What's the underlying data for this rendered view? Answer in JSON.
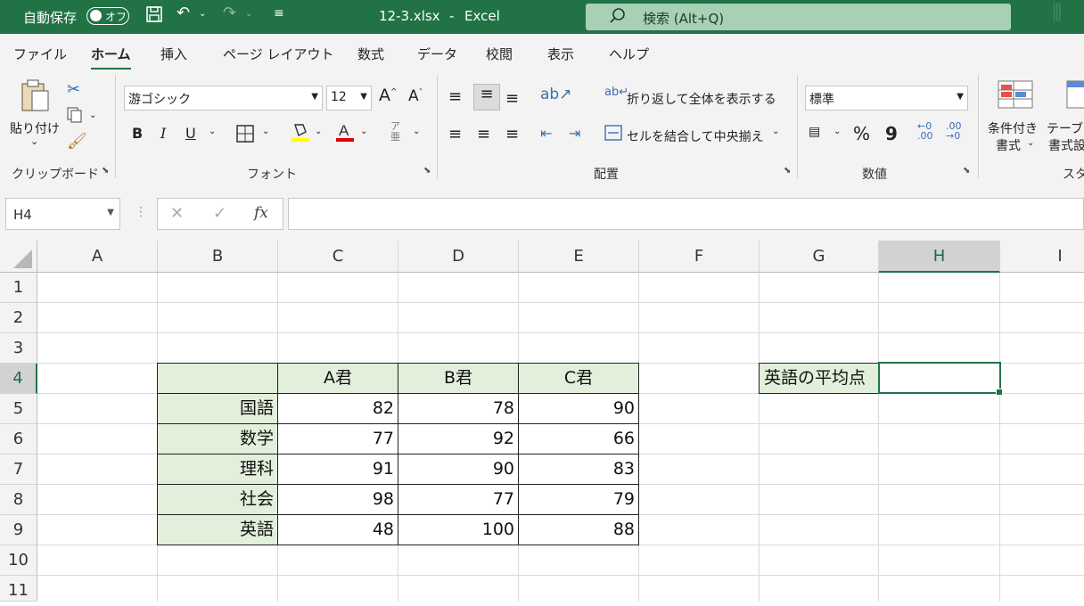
{
  "titlebar": {
    "autosave_label": "自動保存",
    "autosave_state": "オフ",
    "filename": "12-3.xlsx",
    "separator": "-",
    "app_name": "Excel",
    "search_placeholder": "検索 (Alt+Q)"
  },
  "menu": {
    "tabs": [
      "ファイル",
      "ホーム",
      "挿入",
      "ページ レイアウト",
      "数式",
      "データ",
      "校閲",
      "表示",
      "ヘルプ"
    ],
    "active": "ホーム"
  },
  "ribbon": {
    "clipboard": {
      "paste_label": "貼り付け",
      "group_label": "クリップボード"
    },
    "font": {
      "font_name": "游ゴシック",
      "font_size": "12",
      "bold": "B",
      "italic": "I",
      "underline": "U",
      "group_label": "フォント"
    },
    "alignment": {
      "wrap_text": "折り返して全体を表示する",
      "merge_center": "セルを結合して中央揃え",
      "group_label": "配置"
    },
    "number": {
      "format": "標準",
      "percent": "%",
      "comma": "9",
      "group_label": "数値"
    },
    "styles": {
      "conditional_line1": "条件付き",
      "conditional_line2": "書式",
      "table_line1": "テーブル",
      "table_line2": "書式設",
      "group_label": "スタ"
    }
  },
  "formula_bar": {
    "name_box": "H4",
    "fx_label": "fx",
    "formula": ""
  },
  "grid": {
    "columns": [
      "A",
      "B",
      "C",
      "D",
      "E",
      "F",
      "G",
      "H",
      "I"
    ],
    "rows": [
      "1",
      "2",
      "3",
      "4",
      "5",
      "6",
      "7",
      "8",
      "9",
      "10",
      "11"
    ],
    "selected_cell": "H4",
    "table": {
      "headers": [
        "",
        "A君",
        "B君",
        "C君"
      ],
      "subjects": [
        "国語",
        "数学",
        "理科",
        "社会",
        "英語"
      ],
      "scores": [
        [
          "82",
          "78",
          "90"
        ],
        [
          "77",
          "92",
          "66"
        ],
        [
          "91",
          "90",
          "83"
        ],
        [
          "98",
          "77",
          "79"
        ],
        [
          "48",
          "100",
          "88"
        ]
      ]
    },
    "g4_label": "英語の平均点",
    "h4_value": ""
  },
  "colors": {
    "accent": "#217346",
    "table_fill": "#e2efda",
    "search_bg": "#a7d0b4"
  }
}
